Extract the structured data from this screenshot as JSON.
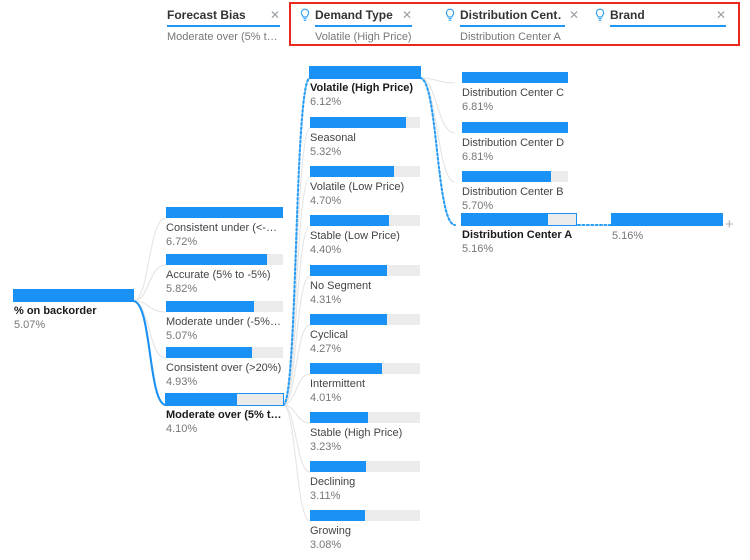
{
  "colors": {
    "bar_fill": "#1a92f5",
    "bar_track": "#ebebeb",
    "accent_underline": "#2296f3",
    "highlight_box": "#e8291c",
    "link_dim": "#e2e2e2",
    "link_active": "#1a92f5"
  },
  "header": {
    "filters": [
      {
        "title": "Forecast Bias",
        "value": "Moderate over (5% to …",
        "close_label": "✕",
        "has_bulb": false,
        "in_highlight": false,
        "underline_width": 112
      },
      {
        "title": "Demand Type",
        "value": "Volatile (High Price)",
        "close_label": "✕",
        "has_bulb": true,
        "in_highlight": true,
        "underline_width": 110
      },
      {
        "title": "Distribution Cent…",
        "value": "Distribution Center A",
        "close_label": "✕",
        "has_bulb": true,
        "in_highlight": true,
        "underline_width": 110
      },
      {
        "title": "Brand",
        "value": "",
        "close_label": "✕",
        "has_bulb": true,
        "in_highlight": true,
        "underline_width": 110
      }
    ]
  },
  "chart_data": {
    "type": "bar",
    "title": "Decomposition tree — % on backorder",
    "xlabel": "",
    "ylabel": "% on backorder",
    "levels": [
      {
        "name": "root",
        "field": "",
        "nodes": [
          {
            "label": "% on backorder",
            "value": "5.07%",
            "numeric": 5.07,
            "fill_pct": 100,
            "selected": true,
            "bold": true
          }
        ]
      },
      {
        "name": "Forecast Bias",
        "field": "Forecast Bias",
        "nodes": [
          {
            "label": "Consistent under (<-2…",
            "value": "6.72%",
            "numeric": 6.72,
            "fill_pct": 100,
            "selected": false,
            "bold": false
          },
          {
            "label": "Accurate (5% to -5%)",
            "value": "5.82%",
            "numeric": 5.82,
            "fill_pct": 86.6,
            "selected": false,
            "bold": false
          },
          {
            "label": "Moderate under (-5% …",
            "value": "5.07%",
            "numeric": 5.07,
            "fill_pct": 75.4,
            "selected": false,
            "bold": false
          },
          {
            "label": "Consistent over (>20%)",
            "value": "4.93%",
            "numeric": 4.93,
            "fill_pct": 73.4,
            "selected": false,
            "bold": false
          },
          {
            "label": "Moderate over (5% t…",
            "value": "4.10%",
            "numeric": 4.1,
            "fill_pct": 61.0,
            "selected": true,
            "bold": true
          }
        ]
      },
      {
        "name": "Demand Type",
        "field": "Demand Type",
        "nodes": [
          {
            "label": "Volatile (High Price)",
            "value": "6.12%",
            "numeric": 6.12,
            "fill_pct": 100,
            "selected": true,
            "bold": true
          },
          {
            "label": "Seasonal",
            "value": "5.32%",
            "numeric": 5.32,
            "fill_pct": 86.9,
            "selected": false,
            "bold": false
          },
          {
            "label": "Volatile (Low Price)",
            "value": "4.70%",
            "numeric": 4.7,
            "fill_pct": 76.8,
            "selected": false,
            "bold": false
          },
          {
            "label": "Stable (Low Price)",
            "value": "4.40%",
            "numeric": 4.4,
            "fill_pct": 71.9,
            "selected": false,
            "bold": false
          },
          {
            "label": "No Segment",
            "value": "4.31%",
            "numeric": 4.31,
            "fill_pct": 70.4,
            "selected": false,
            "bold": false
          },
          {
            "label": "Cyclical",
            "value": "4.27%",
            "numeric": 4.27,
            "fill_pct": 69.8,
            "selected": false,
            "bold": false
          },
          {
            "label": "Intermittent",
            "value": "4.01%",
            "numeric": 4.01,
            "fill_pct": 65.5,
            "selected": false,
            "bold": false
          },
          {
            "label": "Stable (High Price)",
            "value": "3.23%",
            "numeric": 3.23,
            "fill_pct": 52.8,
            "selected": false,
            "bold": false
          },
          {
            "label": "Declining",
            "value": "3.11%",
            "numeric": 3.11,
            "fill_pct": 50.8,
            "selected": false,
            "bold": false
          },
          {
            "label": "Growing",
            "value": "3.08%",
            "numeric": 3.08,
            "fill_pct": 50.3,
            "selected": false,
            "bold": false
          }
        ]
      },
      {
        "name": "Distribution Center",
        "field": "Distribution Cent…",
        "nodes": [
          {
            "label": "Distribution Center C",
            "value": "6.81%",
            "numeric": 6.81,
            "fill_pct": 100,
            "selected": false,
            "bold": false
          },
          {
            "label": "Distribution Center D",
            "value": "6.81%",
            "numeric": 6.81,
            "fill_pct": 100,
            "selected": false,
            "bold": false
          },
          {
            "label": "Distribution Center B",
            "value": "5.70%",
            "numeric": 5.7,
            "fill_pct": 83.7,
            "selected": false,
            "bold": false
          },
          {
            "label": "Distribution Center A",
            "value": "5.16%",
            "numeric": 5.16,
            "fill_pct": 75.8,
            "selected": true,
            "bold": true
          }
        ]
      },
      {
        "name": "Brand",
        "field": "Brand",
        "nodes": [
          {
            "label": "",
            "value": "5.16%",
            "numeric": 5.16,
            "fill_pct": 100,
            "selected": false,
            "bold": false
          }
        ]
      }
    ],
    "expand_icon": "+"
  }
}
